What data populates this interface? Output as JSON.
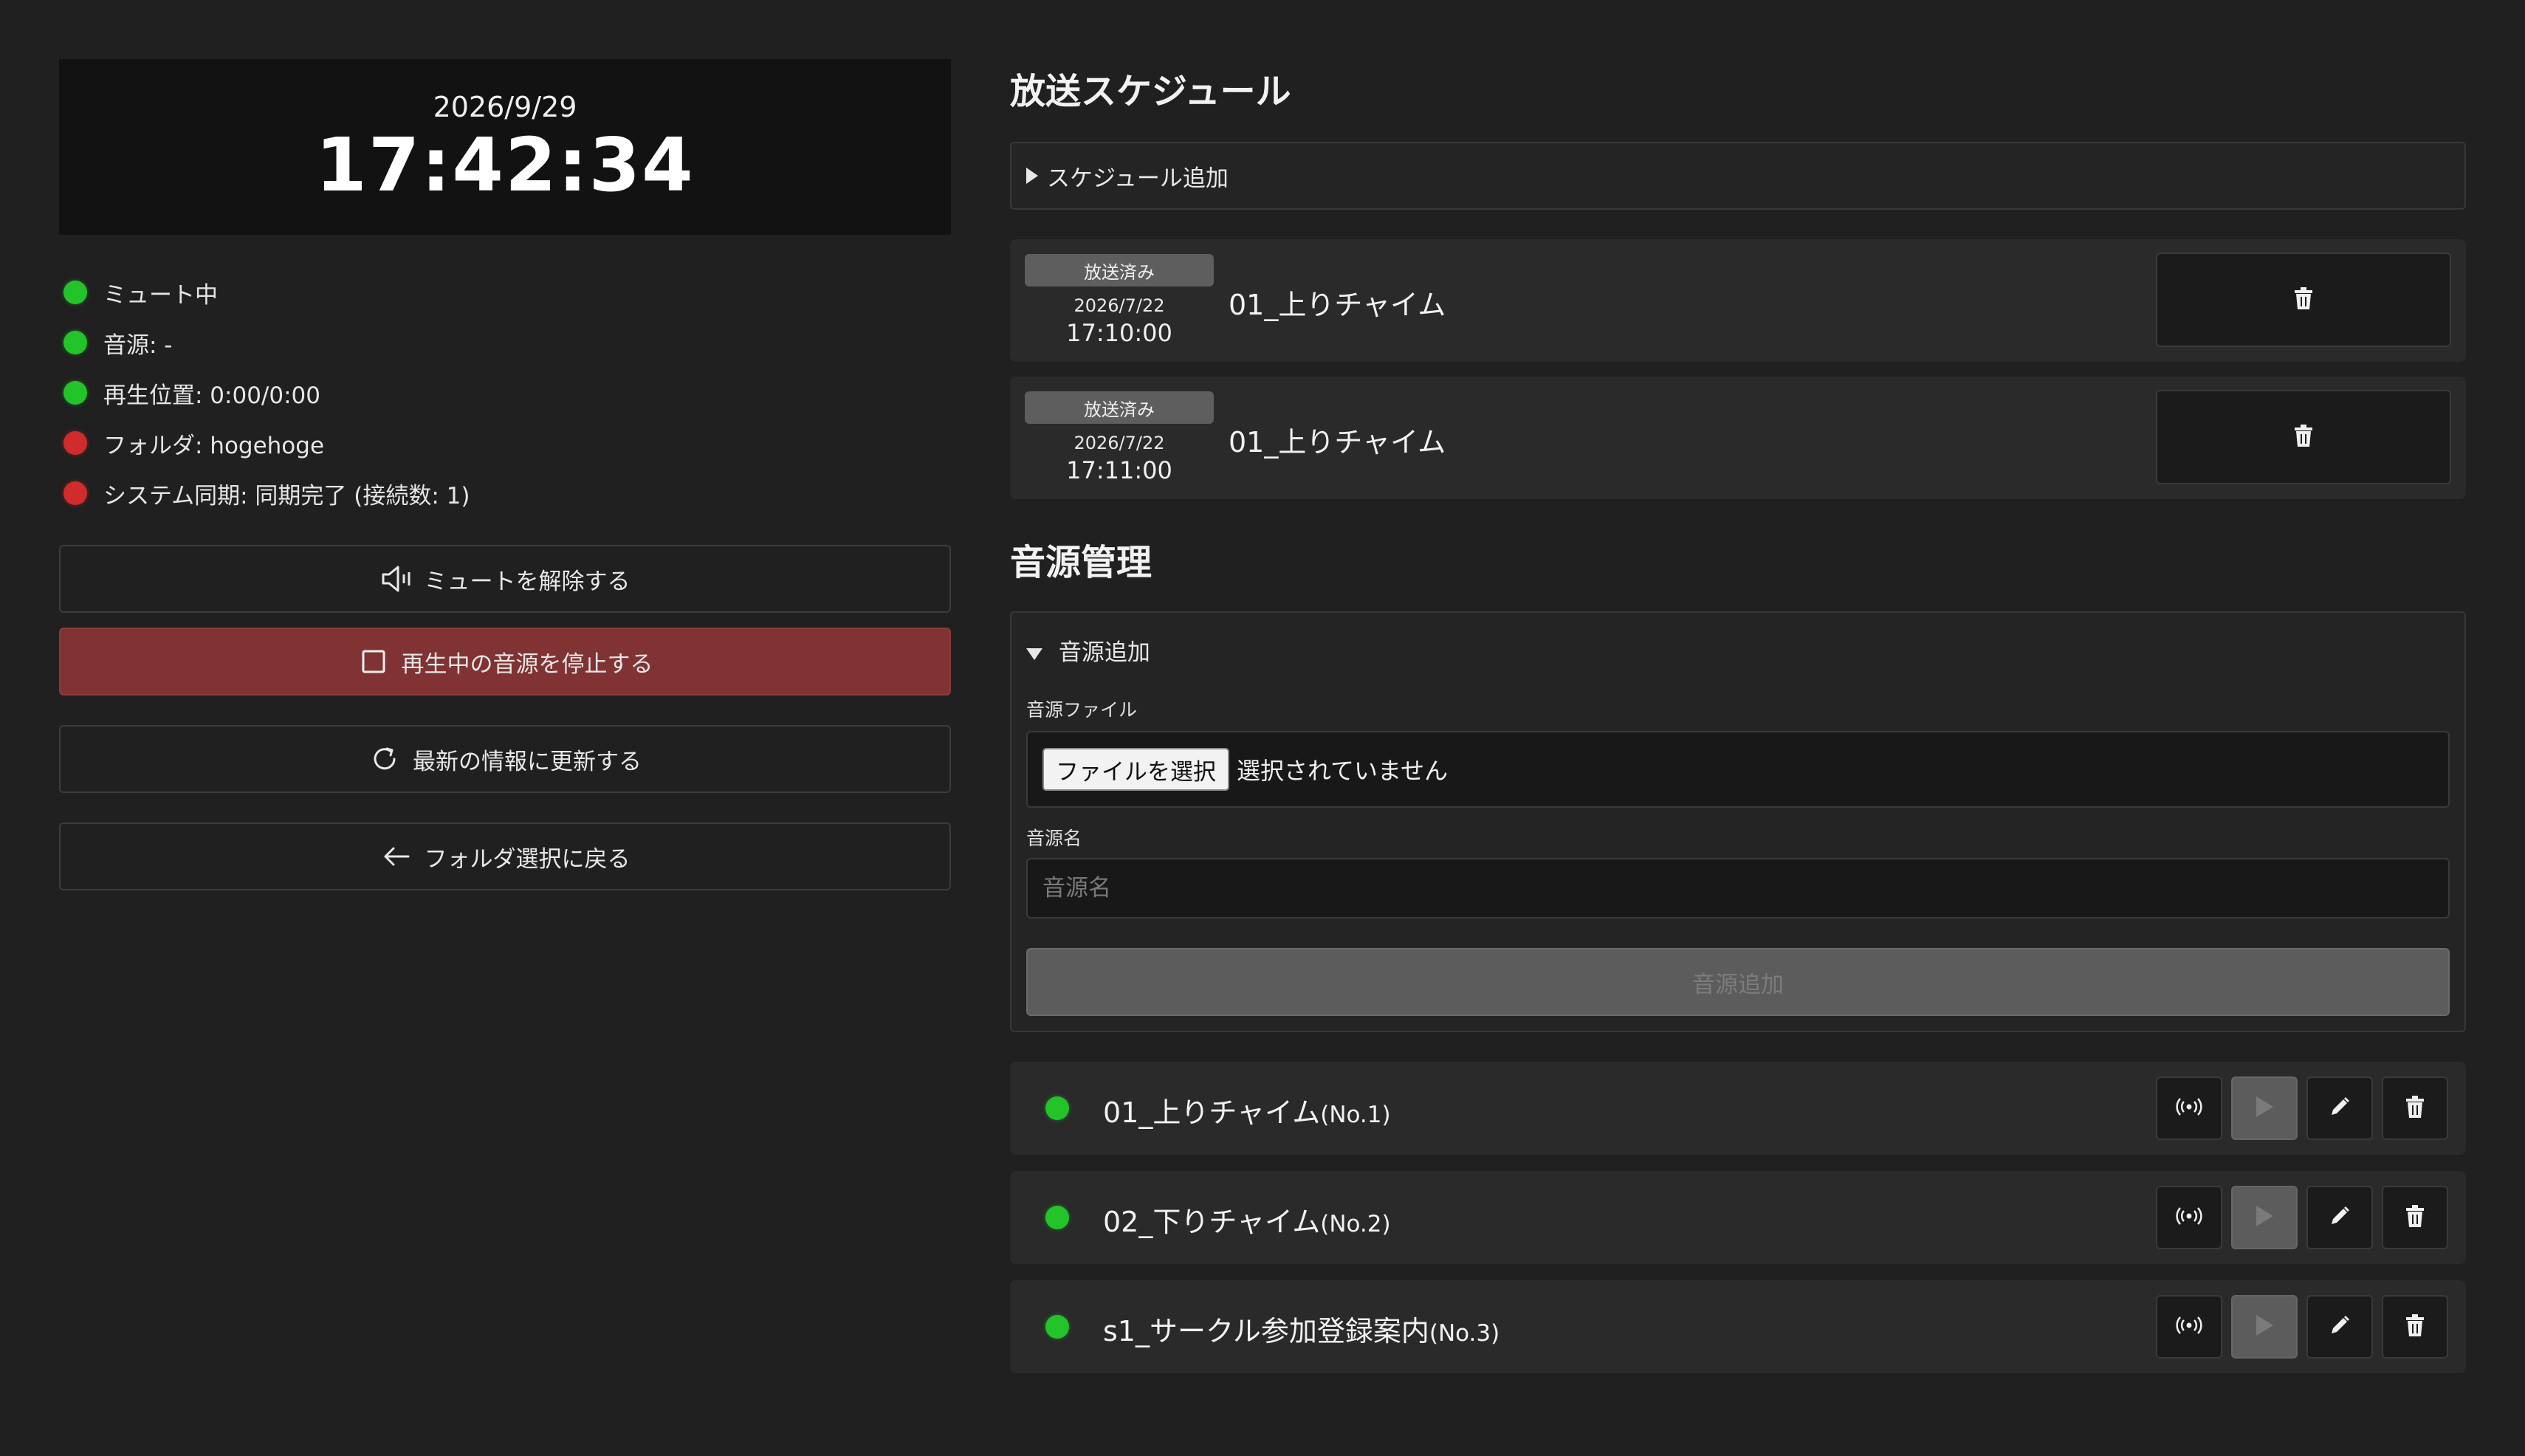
{
  "clock": {
    "date": "2026/9/29",
    "time": "17:42:34"
  },
  "status": [
    {
      "label": "ミュート中",
      "color": "green"
    },
    {
      "label": "音源: -",
      "color": "green"
    },
    {
      "label": "再生位置: 0:00/0:00",
      "color": "green"
    },
    {
      "label": "フォルダ: hogehoge",
      "color": "red"
    },
    {
      "label": "システム同期: 同期完了 (接続数: 1)",
      "color": "red"
    }
  ],
  "buttons": {
    "unmute": {
      "label": "ミュートを解除する",
      "icon": "speaker-icon"
    },
    "stop": {
      "label": "再生中の音源を停止する",
      "icon": "stop-icon"
    },
    "refresh": {
      "label": "最新の情報に更新する",
      "icon": "refresh-icon"
    },
    "back": {
      "label": "フォルダ選択に戻る",
      "icon": "arrow-left-icon"
    }
  },
  "schedule": {
    "heading": "放送スケジュール",
    "add_summary": "スケジュール追加",
    "items": [
      {
        "badge": "放送済み",
        "date": "2026/7/22",
        "time": "17:10:00",
        "name": "01_上りチャイム"
      },
      {
        "badge": "放送済み",
        "date": "2026/7/22",
        "time": "17:11:00",
        "name": "01_上りチャイム"
      }
    ]
  },
  "sources": {
    "heading": "音源管理",
    "add_summary": "音源追加",
    "file_label": "音源ファイル",
    "file_button": "ファイルを選択",
    "file_status": "選択されていません",
    "name_label": "音源名",
    "name_placeholder": "音源名",
    "submit_label": "音源追加",
    "items": [
      {
        "name": "01_上りチャイム",
        "number": "(No.1)"
      },
      {
        "name": "02_下りチャイム",
        "number": "(No.2)"
      },
      {
        "name": "s1_サークル参加登録案内",
        "number": "(No.3)"
      }
    ]
  },
  "colors": {
    "green": "#22c42a",
    "red": "#d12b2b",
    "stop_button": "#813232"
  }
}
